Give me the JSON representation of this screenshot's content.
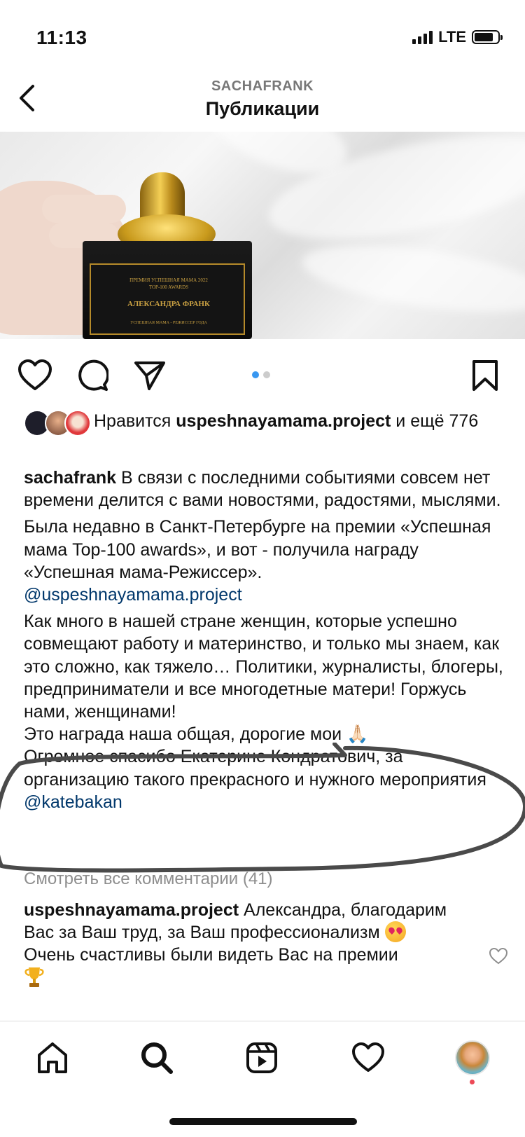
{
  "status_bar": {
    "time": "11:13",
    "network": "LTE"
  },
  "header": {
    "username": "SACHAFRANK",
    "title": "Публикации"
  },
  "image": {
    "plaque_line1": "ПРЕМИЯ УСПЕШНАЯ МАМА 2022",
    "plaque_line2": "TOP-100 AWARDS",
    "plaque_line3": "АЛЕКСАНДРА ФРАНК",
    "plaque_line4": "УСПЕШНАЯ МАМА - РЕЖИССЕР ГОДА"
  },
  "carousel": {
    "count": 2,
    "active": 0
  },
  "likes": {
    "prefix": "Нравится ",
    "user": "uspeshnayamama.project",
    "suffix": " и ещё 776"
  },
  "caption": {
    "author": "sachafrank",
    "p1": " В связи с последними событиями совсем нет времени делится с вами новостями, радостями, мыслями.",
    "p2": "Была недавно в Санкт-Петербурге на премии «Успешная мама Top-100 awards», и вот - получила награду «Успешная мама-Режиссер».",
    "p2_mention": "@uspeshnayamama.project",
    "p3": "Как много в нашей стране женщин, которые успешно совмещают работу и материнство, и только мы знаем, как это сложно, как тяжело… Политики, журналисты, блогеры, предприниматели и все многодетные матери! Горжусь нами, женщинами!",
    "p4": "Это награда наша общая, дорогие мои ",
    "p4_emoji": "🙏🏻",
    "p5": "Огромное спасибо Екатерине Кондратович, за организацию такого прекрасного и нужного мероприятия ",
    "p5_mention": "@katebakan"
  },
  "view_comments": "Смотреть все комментарии (41)",
  "comment": {
    "author": "uspeshnayamama.project",
    "text1": " Александра, благодарим Вас за Ваш труд, за Ваш профессионализм ",
    "text2": "Очень счастливы были видеть Вас на премии"
  },
  "tabs": [
    "home",
    "search",
    "reels",
    "activity",
    "profile"
  ]
}
